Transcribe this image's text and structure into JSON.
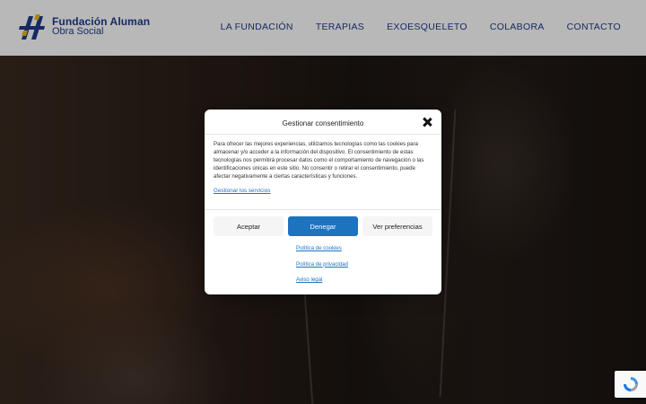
{
  "header": {
    "logo": {
      "title": "Fundación Aluman",
      "subtitle": "Obra Social"
    },
    "nav": [
      {
        "label": "LA FUNDACIÓN"
      },
      {
        "label": "TERAPIAS"
      },
      {
        "label": "EXOESQUELETO"
      },
      {
        "label": "COLABORA"
      },
      {
        "label": "CONTACTO"
      }
    ]
  },
  "consent": {
    "title": "Gestionar consentimiento",
    "message": "Para ofrecer las mejores experiencias, utilizamos tecnologías como las cookies para almacenar y/o acceder a la información del dispositivo. El consentimiento de estas tecnologías nos permitirá procesar datos como el comportamiento de navegación o las identificaciones únicas en este sitio. No consentir o retirar el consentimiento, puede afectar negativamente a ciertas características y funciones.",
    "manage_link": "Gestionar los servicios",
    "buttons": {
      "accept": "Aceptar",
      "deny": "Denegar",
      "preferences": "Ver preferencias"
    },
    "links": [
      "Política de cookies",
      "Política de privacidad",
      "Aviso legal"
    ]
  },
  "colors": {
    "brand_blue": "#1f3a8a",
    "accent_blue": "#1e73be",
    "logo_yellow": "#f5b400"
  },
  "icons": {
    "close": "close-icon",
    "recaptcha": "recaptcha-icon"
  }
}
